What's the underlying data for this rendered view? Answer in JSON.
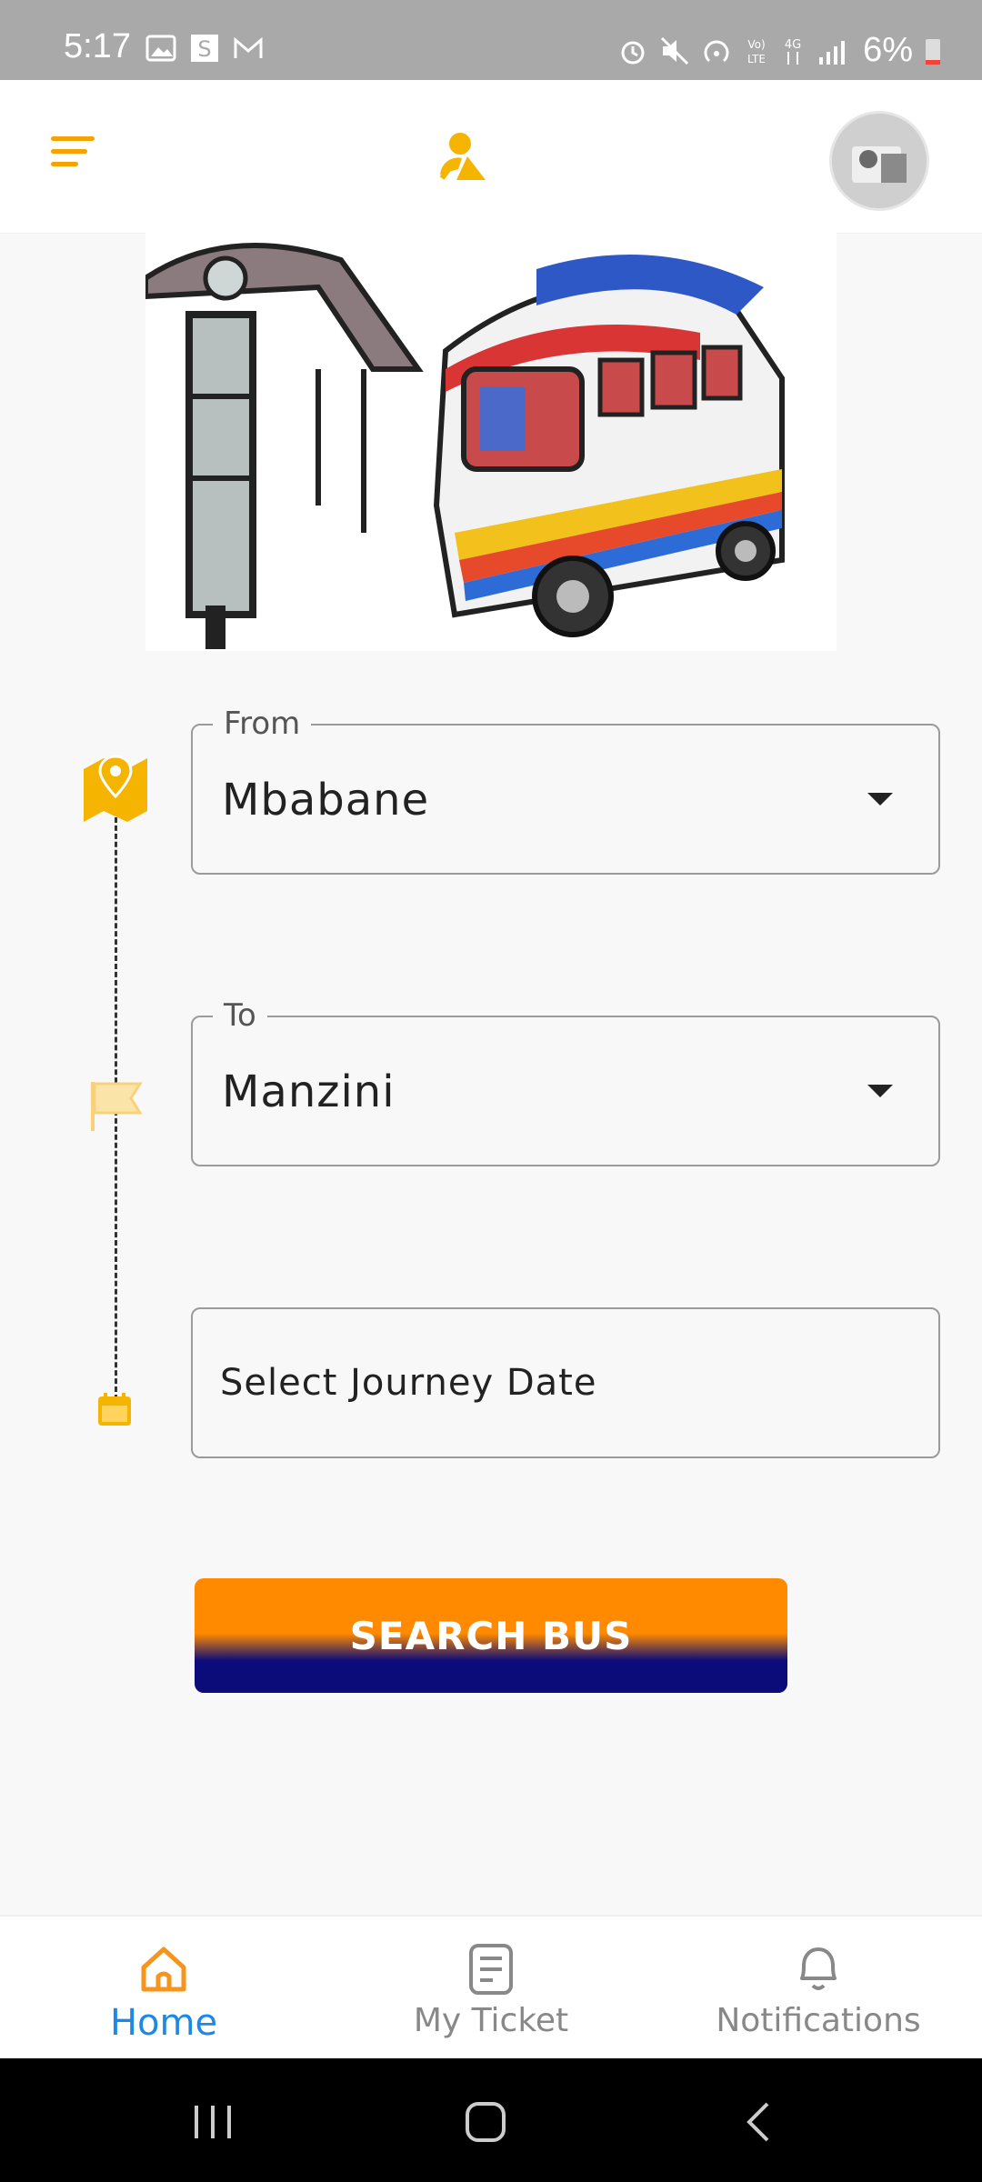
{
  "status_bar": {
    "time": "5:17",
    "battery_percent": "6%",
    "left_icons": [
      "image-icon",
      "s-app-icon",
      "gmail-icon"
    ],
    "right_icons": [
      "alarm-icon",
      "mute-icon",
      "hotspot-icon",
      "volte-icon",
      "4g-icon",
      "signal-icon",
      "battery-icon"
    ]
  },
  "header": {
    "menu_icon": "menu-icon",
    "center_icon": "user-pin-icon",
    "avatar": "profile-avatar"
  },
  "form": {
    "from": {
      "label": "From",
      "value": "Mbabane"
    },
    "to": {
      "label": "To",
      "value": "Manzini"
    },
    "date": {
      "placeholder": "Select Journey Date"
    },
    "search_button": "SEARCH BUS"
  },
  "bottom_nav": {
    "items": [
      {
        "label": "Home",
        "icon": "home-icon",
        "active": true
      },
      {
        "label": "My Ticket",
        "icon": "ticket-icon",
        "active": false
      },
      {
        "label": "Notifications",
        "icon": "bell-icon",
        "active": false
      }
    ]
  },
  "colors": {
    "accent": "#f5a300",
    "button_top": "#ff8a00",
    "button_bottom": "#0b0b7a",
    "active_nav": "#1e88e5"
  }
}
